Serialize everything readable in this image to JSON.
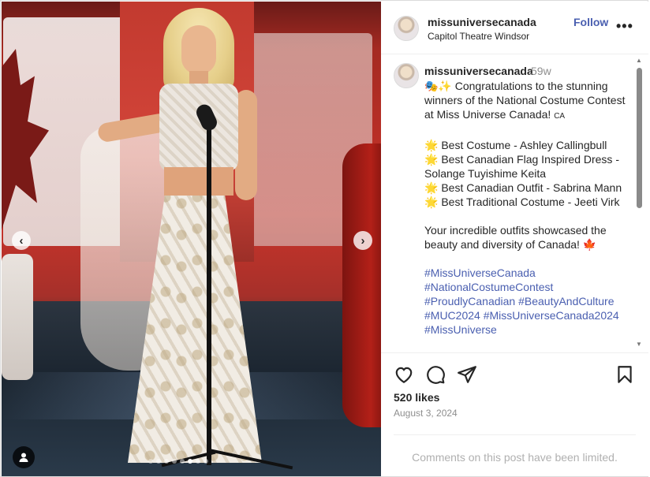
{
  "post": {
    "username": "missuniversecanada",
    "location": "Capitol Theatre Windsor",
    "follow_label": "Follow",
    "more_label": "•••"
  },
  "caption": {
    "username": "missuniversecanada",
    "time": "59w",
    "lines": [
      "🎭✨ Congratulations to the stunning winners of the National Costume Contest at Miss Universe Canada!",
      "🌟 Best Costume - Ashley Callingbull",
      "🌟 Best Canadian Flag Inspired Dress - Solange Tuyishime Keita",
      "🌟 Best Canadian Outfit - Sabrina Mann",
      "🌟 Best Traditional Costume - Jeeti Virk",
      "Your incredible outfits showcased the beauty and diversity of Canada! 🍁"
    ],
    "flag_suffix": "CA",
    "hashtags": [
      "#MissUniverseCanada",
      "#NationalCostumeContest",
      "#ProudlyCanadian #BeautyAndCulture",
      "#MUC2024 #MissUniverseCanada2024",
      "#MissUniverse"
    ]
  },
  "engagement": {
    "likes": "520 likes",
    "date": "August 3, 2024",
    "comments_limited": "Comments on this post have been limited."
  },
  "carousel": {
    "prev": "‹",
    "next": "›",
    "slide_count": 8,
    "active_slide": 5
  }
}
